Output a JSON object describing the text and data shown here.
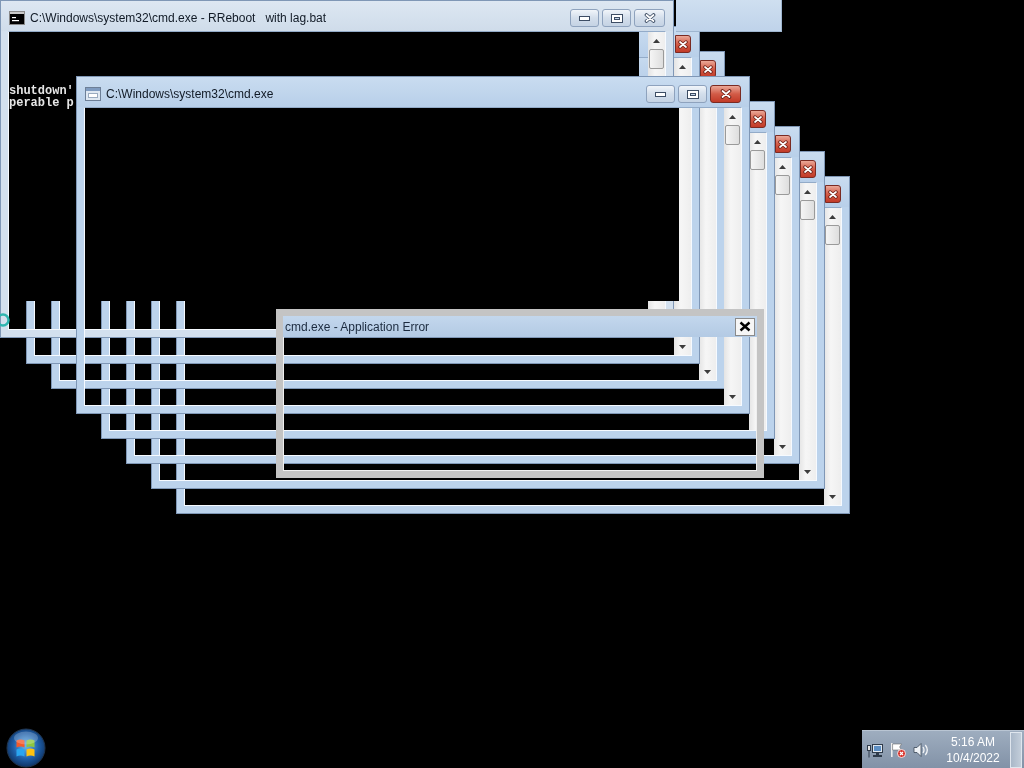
{
  "windows": [
    {
      "kind": "console",
      "active": false,
      "title": "C:\\Windows\\system32\\cmd.exe - RReboot   with lag.bat",
      "lines": [
        "shutdown'",
        "perable p"
      ]
    },
    {
      "kind": "trail",
      "active": true
    },
    {
      "kind": "trail",
      "active": true
    },
    {
      "kind": "console",
      "active": true,
      "title": "C:\\Windows\\system32\\cmd.exe"
    },
    {
      "kind": "trail",
      "active": true
    },
    {
      "kind": "trail",
      "active": true
    },
    {
      "kind": "trail",
      "active": true
    },
    {
      "kind": "trail",
      "active": true
    }
  ],
  "error_dialog": {
    "title": "cmd.exe - Application Error"
  },
  "taskbar": {
    "clock": {
      "time": "5:16 AM",
      "date": "10/4/2022"
    }
  }
}
